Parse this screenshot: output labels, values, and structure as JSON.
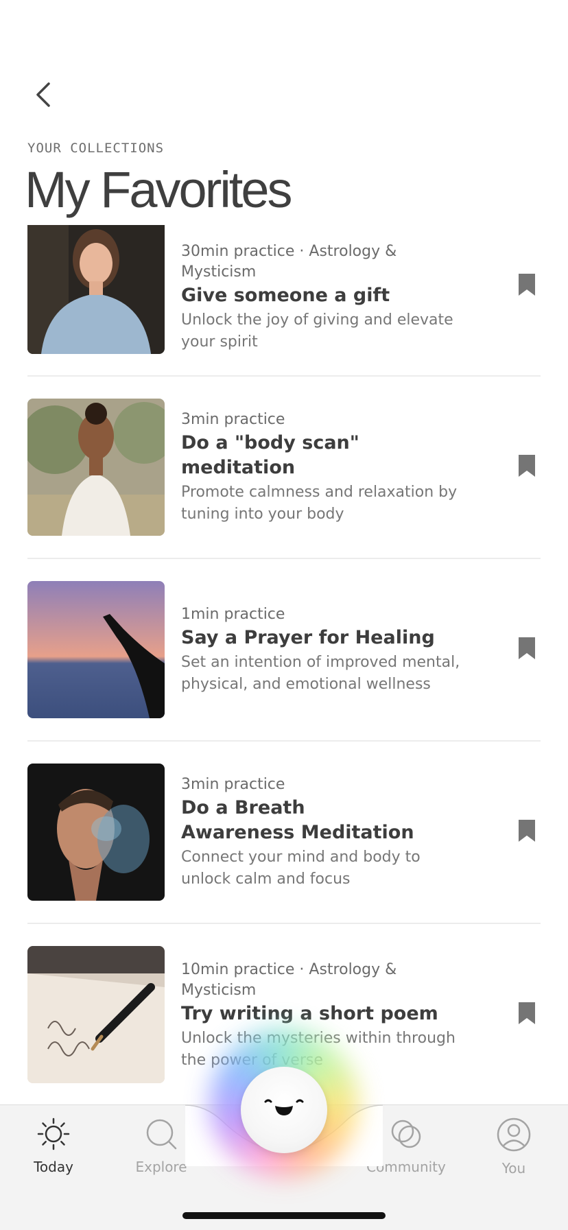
{
  "header": {
    "eyebrow": "YOUR COLLECTIONS",
    "title": "My Favorites"
  },
  "items": [
    {
      "meta": "30min practice · Astrology & Mysticism",
      "title": "Give someone a gift",
      "description": "Unlock the joy of giving and elevate your spirit"
    },
    {
      "meta": "3min practice",
      "title": "Do a \"body scan\" meditation",
      "description": "Promote calmness and relaxation by tuning into your body"
    },
    {
      "meta": "1min practice",
      "title": "Say a Prayer for Healing",
      "description": "Set an intention of improved mental, physical, and emotional wellness"
    },
    {
      "meta": "3min practice",
      "title": "Do a Breath Awareness Meditation",
      "description": "Connect your mind and body to unlock calm and focus"
    },
    {
      "meta": "10min practice · Astrology & Mysticism",
      "title": "Try writing a short poem",
      "description": "Unlock the mysteries within through the power of verse"
    }
  ],
  "tabs": [
    {
      "label": "Today",
      "icon": "sun-icon",
      "active": true
    },
    {
      "label": "Explore",
      "icon": "search-icon",
      "active": false
    },
    {
      "label": "Community",
      "icon": "community-icon",
      "active": false
    },
    {
      "label": "You",
      "icon": "profile-icon",
      "active": false
    }
  ],
  "colors": {
    "active_tab": "#333333",
    "inactive_tab": "#a3a3a3",
    "bookmark": "#757575"
  }
}
